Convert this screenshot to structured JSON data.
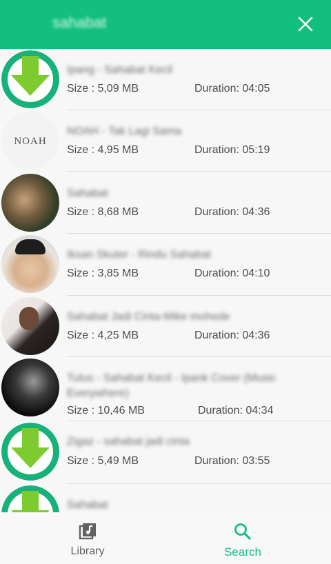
{
  "search": {
    "query": "sahabat"
  },
  "results": [
    {
      "title": "Ipang - Sahabat Kecil",
      "size": "Size : 5,09 MB",
      "duration": "Duration: 04:05"
    },
    {
      "title": "NOAH - Tak Lagi Sama",
      "size": "Size : 4,95 MB",
      "duration": "Duration: 05:19"
    },
    {
      "title": "Sahabat",
      "size": "Size : 8,68 MB",
      "duration": "Duration: 04:36"
    },
    {
      "title": "Iksan Skuter - Rindu Sahabat",
      "size": "Size : 3,85 MB",
      "duration": "Duration: 04:10"
    },
    {
      "title": "Sahabat Jadi Cinta-Mike mohede",
      "size": "Size : 4,25 MB",
      "duration": "Duration: 04:36"
    },
    {
      "title": "Tulus - Sahabat Kecil - Ipank Cover (Music Everywhere)",
      "size": "Size : 10,46 MB",
      "duration": "Duration: 04:34"
    },
    {
      "title": "Zigaz - sahabat jadi cinta",
      "size": "Size : 5,49 MB",
      "duration": "Duration: 03:55"
    },
    {
      "title": "Sahabat",
      "size": "",
      "duration": ""
    }
  ],
  "thumbs": {
    "noah_text": "NOAH"
  },
  "nav": [
    {
      "label": "Library",
      "icon": "library-music-icon",
      "active": false
    },
    {
      "label": "Search",
      "icon": "search-icon",
      "active": true
    }
  ],
  "colors": {
    "accent": "#12bf7d",
    "download_green": "#7dcb2e"
  }
}
